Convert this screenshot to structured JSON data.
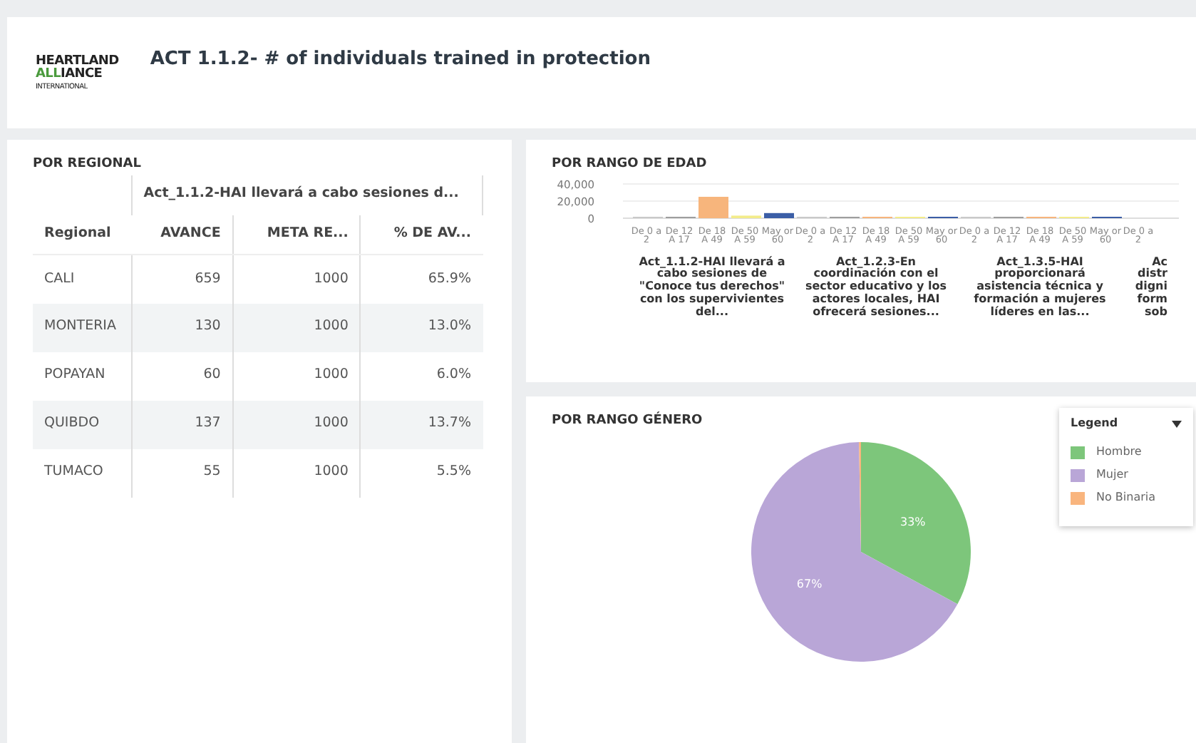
{
  "header": {
    "logo": {
      "line_1": "HEARTLAND",
      "line_2_accent": "ALL",
      "line_2_rest": "IANCE",
      "line_3": "INTERNATIONAL"
    },
    "title": "ACT 1.1.2- # of individuals trained in protection"
  },
  "regional": {
    "title": "POR REGIONAL",
    "group_header": "Act_1.1.2-HAI llevará a cabo sesiones d...",
    "columns": [
      "Regional",
      "AVANCE",
      "META RE...",
      "% DE AV..."
    ],
    "rows": [
      [
        "CALI",
        "659",
        "1000",
        "65.9%"
      ],
      [
        "MONTERIA",
        "130",
        "1000",
        "13.0%"
      ],
      [
        "POPAYAN",
        "60",
        "1000",
        "6.0%"
      ],
      [
        "QUIBDO",
        "137",
        "1000",
        "13.7%"
      ],
      [
        "TUMACO",
        "55",
        "1000",
        "5.5%"
      ]
    ]
  },
  "age": {
    "title": "POR RANGO DE EDAD",
    "chart_data": {
      "type": "bar",
      "categories": [
        "Act_1.1.2-HAI llevará a cabo sesiones de \"Conoce tus derechos\" con los supervivientes del...",
        "Act_1.2.3-En coordinación con el sector educativo y los actores locales, HAI ofrecerá sesiones...",
        "Act_1.3.5-HAI proporcionará asistencia técnica y formación a mujeres líderes en las..."
      ],
      "series": [
        {
          "name": "De 0 a 2",
          "color": "#c9c9c9",
          "values": [
            0,
            0,
            0
          ]
        },
        {
          "name": "De 12 A 17",
          "color": "#9e9e9e",
          "values": [
            0,
            0,
            0
          ]
        },
        {
          "name": "De 18 A 49",
          "color": "#f7b57c",
          "values": [
            25000,
            0,
            0
          ]
        },
        {
          "name": "De 50 A 59",
          "color": "#f3ec8a",
          "values": [
            3000,
            0,
            0
          ]
        },
        {
          "name": "May or 60",
          "color": "#3b5ea6",
          "values": [
            6000,
            0,
            0
          ]
        }
      ],
      "ylim": [
        0,
        40000
      ],
      "yticks": [
        {
          "value": 0,
          "label": "0"
        },
        {
          "value": 20000,
          "label": "20,000"
        },
        {
          "value": 40000,
          "label": "40,000"
        }
      ],
      "stacked": false,
      "orientation": "vertical"
    },
    "cut_group": {
      "age_label": "De 0 a 2",
      "title_lines": [
        "Ac",
        "distr",
        "digni",
        "form",
        "sob"
      ]
    }
  },
  "gender": {
    "title": "POR RANGO GÉNERO",
    "chart_data": {
      "type": "pie",
      "categories": [
        "Hombre",
        "Mujer",
        "No Binaria"
      ],
      "values": [
        33,
        67,
        0.3
      ],
      "colors": [
        "#7dc67b",
        "#b9a6d7",
        "#f9b57e"
      ],
      "value_labels": [
        "33%",
        "67%",
        null
      ]
    },
    "legend": {
      "title": "Legend"
    }
  }
}
